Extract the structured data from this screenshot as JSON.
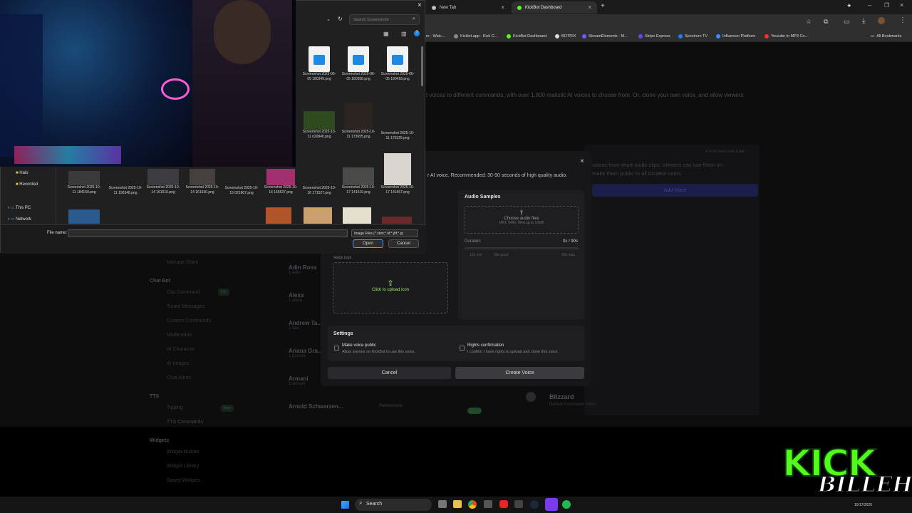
{
  "browser": {
    "tabs": [
      {
        "label": "New Tab",
        "icon": "chrome-icon",
        "active": false
      },
      {
        "label": "KickBot Dashboard",
        "icon": "kickbot-icon",
        "active": true
      }
    ],
    "bookmarks": [
      {
        "label": "m - Watc...",
        "icon": "bookmark-icon"
      },
      {
        "label": "Kicklet.app - Kick C...",
        "icon": "bookmark-icon"
      },
      {
        "label": "KickBot Dashboard",
        "icon": "bookmark-icon"
      },
      {
        "label": "BOTRIX",
        "icon": "bookmark-icon"
      },
      {
        "label": "StreamElements - M...",
        "icon": "bookmark-icon"
      },
      {
        "label": "Stripe Express",
        "icon": "bookmark-icon"
      },
      {
        "label": "Spectrum TV",
        "icon": "bookmark-icon"
      },
      {
        "label": "Influencer Platform",
        "icon": "bookmark-icon"
      },
      {
        "label": "Youtube to MP3 Co...",
        "icon": "bookmark-icon"
      }
    ],
    "all_bookmarks": "All Bookmarks"
  },
  "page": {
    "intro": "t voices to different commands, with over 1,800 realistic AI voices to choose from. Or, clone your own voice, and allow viewers",
    "sidebar": {
      "manage_team": "Manage Team",
      "chat_bot_head": "Chat Bot",
      "chat_items": [
        "Clip Command",
        "Timed Messages",
        "Custom Commands",
        "Moderation",
        "AI Character",
        "AI Images",
        "Chat Alerts"
      ],
      "hot_badge": "Hot",
      "tts_head": "TTS",
      "tts_items": [
        "Tipping",
        "TTS Commands"
      ],
      "new_badge": "New",
      "widgets_head": "Widgets",
      "widget_items": [
        "Widget Builder",
        "Widget Library",
        "Saved Widgets"
      ]
    },
    "voices": [
      {
        "name": "Adin Ross",
        "sub": "1 Adin"
      },
      {
        "name": "Alexa",
        "sub": "1 alexa"
      },
      {
        "name": "Andrew Ta...",
        "sub": "1 tate"
      },
      {
        "name": "Ariana Gra...",
        "sub": "1 grande"
      },
      {
        "name": "Armani",
        "sub": "1 armani"
      },
      {
        "name": "Arnold Schwarzen...",
        "sub": "Permissions"
      }
    ],
    "custom_voice_desc": "voices from short audio clips. Viewers can use them on",
    "custom_voice_desc2": "make them public to all KickBot users.",
    "voice_slots": "4 of 10 Voice Slots Used",
    "add_voice": "Add Voice",
    "public_label": "Public",
    "blizzard": {
      "name": "Blizzard",
      "sub": "Default Command: !blizz"
    }
  },
  "modal": {
    "recommendation": "r AI voice. Recommended: 30-90 seconds of high quality audio.",
    "audio_samples_title": "Audio Samples",
    "choose_audio": "Choose audio files",
    "audio_formats": "MP3, WAV, M4A up to 10MB",
    "duration_label": "Duration",
    "duration_value": "0s / 90s",
    "duration_progress": 0,
    "duration_marks": [
      "10s min",
      "30s good",
      "90s max"
    ],
    "voice_icon_label": "Voice Icon",
    "upload_icon": "Click to upload icon",
    "settings_title": "Settings",
    "make_public_title": "Make voice public",
    "make_public_desc": "Allow anyone on KickBot to use this voice.",
    "rights_title": "Rights confirmation",
    "rights_desc": "I confirm I have rights to upload and clone this voice.",
    "cancel": "Cancel",
    "create": "Create Voice"
  },
  "file_dialog": {
    "search_placeholder": "Search Screenshots",
    "nav": [
      "Halo",
      "Recorded",
      "This PC",
      "Network"
    ],
    "files_row1": [
      {
        "name": "Screenshot 2025-06-05 180349.png",
        "icon": "image-file-icon"
      },
      {
        "name": "Screenshot 2025-06-05 180358.png",
        "icon": "image-file-icon"
      },
      {
        "name": "Screenshot 2025-06-05 180418.png",
        "icon": "image-file-icon"
      }
    ],
    "files_row2": [
      {
        "name": "Screenshot 2025-10-11 020840.png"
      },
      {
        "name": "Screenshot 2025-10-11 173655.png"
      },
      {
        "name": "Screenshot 2025-10-11 175325.png"
      }
    ],
    "files_row3": [
      {
        "name": "Screenshot 2025-10-11 184159.png"
      },
      {
        "name": "Screenshot 2025-10-11 190348.png"
      },
      {
        "name": "Screenshot 2025-10-14 161515.png"
      },
      {
        "name": "Screenshot 2025-10-14 161530.png"
      },
      {
        "name": "Screenshot 2025-10-15 021807.png"
      },
      {
        "name": "Screenshot 2025-10-16 165637.png"
      },
      {
        "name": "Screenshot 2025-10-16 171527.png"
      },
      {
        "name": "Screenshot 2025-10-17 141519.png"
      },
      {
        "name": "Screenshot 2025-10-17 141557.png"
      }
    ],
    "file_name_label": "File name:",
    "file_name_value": "",
    "filter": "Image Files (*.xbm;*.tif;*.jfif;*.pj",
    "open": "Open",
    "cancel": "Cancel"
  },
  "taskbar": {
    "search": "Search",
    "date": "10/17/2025"
  },
  "overlay_logo": {
    "line1": "KICK",
    "line2": "BILLEH"
  }
}
